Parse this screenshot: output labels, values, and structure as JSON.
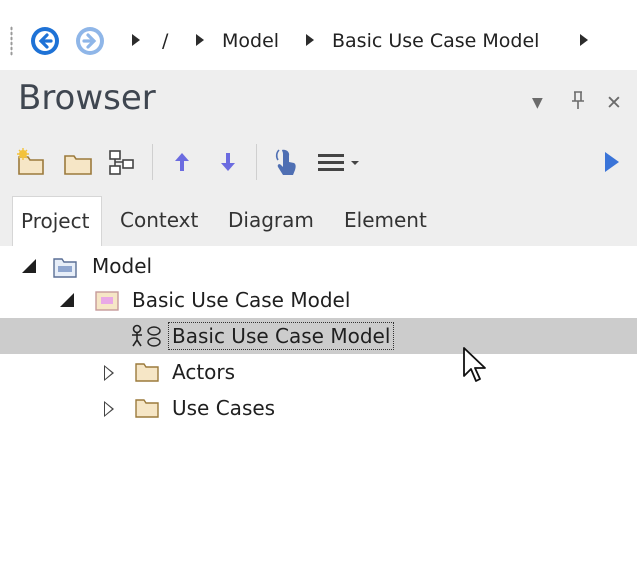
{
  "navigation": {
    "back_icon": "arrow-left-circle-icon",
    "forward_icon": "arrow-right-circle-icon",
    "path": [
      "/",
      "Model",
      "Basic Use Case Model"
    ]
  },
  "browser": {
    "title": "Browser",
    "controls": {
      "menu": "▼",
      "pin": "⊥",
      "close": "✕"
    }
  },
  "toolbar": {
    "icons": [
      "new-package-icon",
      "folder-icon",
      "hierarchy-icon",
      "move-up-icon",
      "move-down-icon",
      "locate-icon",
      "menu-icon",
      "expand-right-icon"
    ]
  },
  "tabs": [
    {
      "label": "Project",
      "active": true
    },
    {
      "label": "Context",
      "active": false
    },
    {
      "label": "Diagram",
      "active": false
    },
    {
      "label": "Element",
      "active": false
    }
  ],
  "tree": {
    "model": "Model",
    "package": "Basic Use Case Model",
    "diagram": "Basic Use Case Model",
    "actors": "Actors",
    "use_cases": "Use Cases"
  },
  "colors": {
    "accent_blue": "#1e72d6",
    "header_bg": "#eeeeee",
    "selection_bg": "#cccccc",
    "arrow_purple": "#6b6be0",
    "folder_fill": "#f6e6c6"
  }
}
